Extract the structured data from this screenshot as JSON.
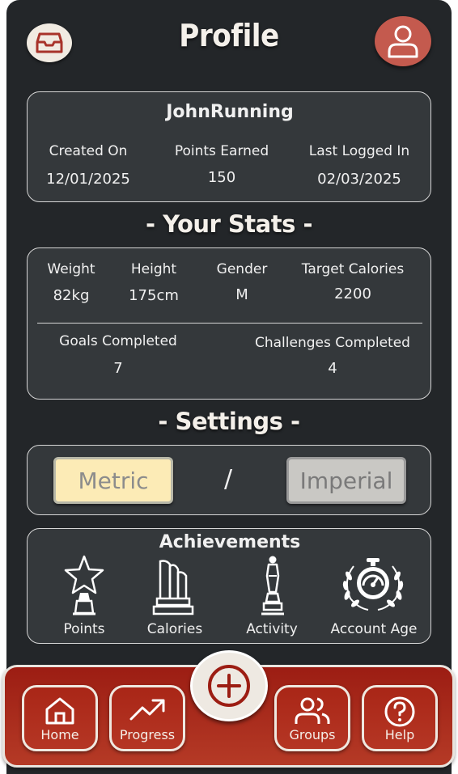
{
  "header": {
    "title": "Profile",
    "inbox_icon": "inbox-icon",
    "avatar_icon": "user-icon"
  },
  "user": {
    "username": "JohnRunning",
    "created_label": "Created On",
    "created_value": "12/01/2025",
    "points_label": "Points Earned",
    "points_value": "150",
    "last_login_label": "Last Logged In",
    "last_login_value": "02/03/2025"
  },
  "stats": {
    "title": "- Your Stats -",
    "weight_label": "Weight",
    "weight_value": "82kg",
    "height_label": "Height",
    "height_value": "175cm",
    "gender_label": "Gender",
    "gender_value": "M",
    "calories_label": "Target Calories",
    "calories_value": "2200",
    "goals_label": "Goals Completed",
    "goals_value": "7",
    "challenges_label": "Challenges Completed",
    "challenges_value": "4"
  },
  "settings": {
    "title": "- Settings -",
    "metric_label": "Metric",
    "separator": "/",
    "imperial_label": "Imperial"
  },
  "achievements": {
    "title": "Achievements",
    "items": [
      {
        "label": "Points",
        "icon": "star-trophy-icon"
      },
      {
        "label": "Calories",
        "icon": "pillar-trophy-icon"
      },
      {
        "label": "Activity",
        "icon": "statue-trophy-icon"
      },
      {
        "label": "Account Age",
        "icon": "stopwatch-laurel-icon"
      }
    ]
  },
  "nav": {
    "items": [
      {
        "label": "Home",
        "icon": "home-icon"
      },
      {
        "label": "Progress",
        "icon": "trend-up-icon"
      },
      {
        "label": "Groups",
        "icon": "users-icon"
      },
      {
        "label": "Help",
        "icon": "help-icon"
      }
    ],
    "add_icon": "plus-circle-icon"
  },
  "colors": {
    "background": "#232629",
    "card": "#34383b",
    "nav_red": "#a92617",
    "avatar": "#c45a4e",
    "metric_selected": "#fcebb6"
  }
}
